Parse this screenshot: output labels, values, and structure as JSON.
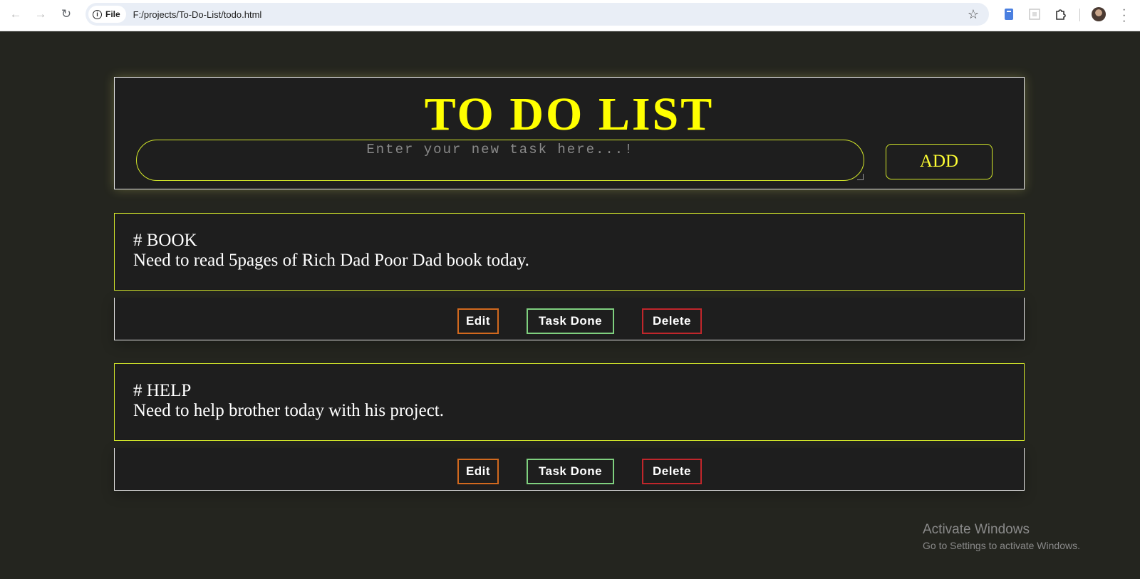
{
  "browser": {
    "site_chip": "File",
    "url": "F:/projects/To-Do-List/todo.html"
  },
  "app": {
    "title": "TO DO LIST",
    "input_placeholder": "Enter your new task here...!",
    "add_label": "ADD"
  },
  "tasks": [
    {
      "title": "# BOOK",
      "description": "Need to read 5pages of Rich Dad Poor Dad book today.",
      "edit_label": "Edit",
      "done_label": "Task Done",
      "delete_label": "Delete"
    },
    {
      "title": "# HELP",
      "description": "Need to help brother today with his project.",
      "edit_label": "Edit",
      "done_label": "Task Done",
      "delete_label": "Delete"
    }
  ],
  "watermark": {
    "title": "Activate Windows",
    "subtitle": "Go to Settings to activate Windows."
  },
  "colors": {
    "accent": "#ffff00",
    "border_accent": "#d4e82a",
    "edit": "#d2691e",
    "done": "#7fd07f",
    "delete": "#c0262b",
    "background": "#24251f"
  }
}
